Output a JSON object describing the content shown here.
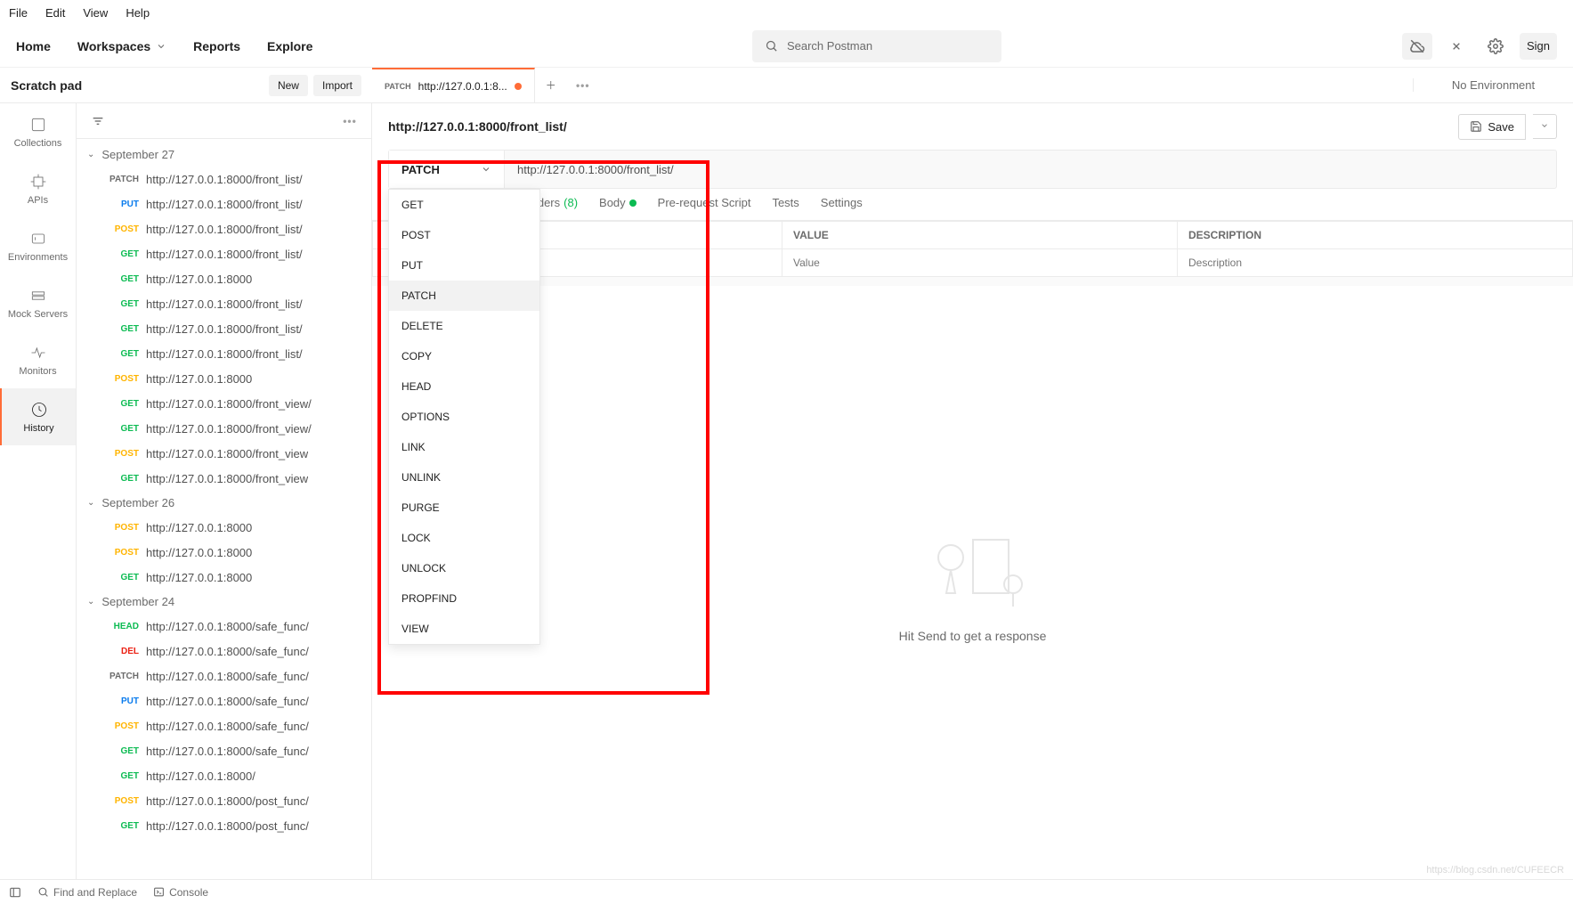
{
  "menu": {
    "file": "File",
    "edit": "Edit",
    "view": "View",
    "help": "Help"
  },
  "header": {
    "home": "Home",
    "workspaces": "Workspaces",
    "reports": "Reports",
    "explore": "Explore",
    "search_placeholder": "Search Postman",
    "sign": "Sign"
  },
  "workspace": {
    "title": "Scratch pad",
    "new": "New",
    "import": "Import"
  },
  "tab": {
    "method": "PATCH",
    "label": "http://127.0.0.1:8...",
    "env": "No Environment"
  },
  "rail": {
    "collections": "Collections",
    "apis": "APIs",
    "environments": "Environments",
    "mockservers": "Mock Servers",
    "monitors": "Monitors",
    "history": "History"
  },
  "history": {
    "groups": [
      {
        "date": "September 27",
        "items": [
          {
            "method": "PATCH",
            "mclass": "m-patch",
            "url": "http://127.0.0.1:8000/front_list/"
          },
          {
            "method": "PUT",
            "mclass": "m-put",
            "url": "http://127.0.0.1:8000/front_list/"
          },
          {
            "method": "POST",
            "mclass": "m-post",
            "url": "http://127.0.0.1:8000/front_list/"
          },
          {
            "method": "GET",
            "mclass": "m-get",
            "url": "http://127.0.0.1:8000/front_list/"
          },
          {
            "method": "GET",
            "mclass": "m-get",
            "url": "http://127.0.0.1:8000"
          },
          {
            "method": "GET",
            "mclass": "m-get",
            "url": "http://127.0.0.1:8000/front_list/"
          },
          {
            "method": "GET",
            "mclass": "m-get",
            "url": "http://127.0.0.1:8000/front_list/"
          },
          {
            "method": "GET",
            "mclass": "m-get",
            "url": "http://127.0.0.1:8000/front_list/"
          },
          {
            "method": "POST",
            "mclass": "m-post",
            "url": "http://127.0.0.1:8000"
          },
          {
            "method": "GET",
            "mclass": "m-get",
            "url": "http://127.0.0.1:8000/front_view/"
          },
          {
            "method": "GET",
            "mclass": "m-get",
            "url": "http://127.0.0.1:8000/front_view/"
          },
          {
            "method": "POST",
            "mclass": "m-post",
            "url": "http://127.0.0.1:8000/front_view"
          },
          {
            "method": "GET",
            "mclass": "m-get",
            "url": "http://127.0.0.1:8000/front_view"
          }
        ]
      },
      {
        "date": "September 26",
        "items": [
          {
            "method": "POST",
            "mclass": "m-post",
            "url": "http://127.0.0.1:8000"
          },
          {
            "method": "POST",
            "mclass": "m-post",
            "url": "http://127.0.0.1:8000"
          },
          {
            "method": "GET",
            "mclass": "m-get",
            "url": "http://127.0.0.1:8000"
          }
        ]
      },
      {
        "date": "September 24",
        "items": [
          {
            "method": "HEAD",
            "mclass": "m-head",
            "url": "http://127.0.0.1:8000/safe_func/"
          },
          {
            "method": "DEL",
            "mclass": "m-del",
            "url": "http://127.0.0.1:8000/safe_func/"
          },
          {
            "method": "PATCH",
            "mclass": "m-patch",
            "url": "http://127.0.0.1:8000/safe_func/"
          },
          {
            "method": "PUT",
            "mclass": "m-put",
            "url": "http://127.0.0.1:8000/safe_func/"
          },
          {
            "method": "POST",
            "mclass": "m-post",
            "url": "http://127.0.0.1:8000/safe_func/"
          },
          {
            "method": "GET",
            "mclass": "m-get",
            "url": "http://127.0.0.1:8000/safe_func/"
          },
          {
            "method": "GET",
            "mclass": "m-get",
            "url": "http://127.0.0.1:8000/"
          },
          {
            "method": "POST",
            "mclass": "m-post",
            "url": "http://127.0.0.1:8000/post_func/"
          },
          {
            "method": "GET",
            "mclass": "m-get",
            "url": "http://127.0.0.1:8000/post_func/"
          }
        ]
      }
    ]
  },
  "request": {
    "name": "http://127.0.0.1:8000/front_list/",
    "save": "Save",
    "method": "PATCH",
    "url": "http://127.0.0.1:8000/front_list/",
    "methods": [
      "GET",
      "POST",
      "PUT",
      "PATCH",
      "DELETE",
      "COPY",
      "HEAD",
      "OPTIONS",
      "LINK",
      "UNLINK",
      "PURGE",
      "LOCK",
      "UNLOCK",
      "PROPFIND",
      "VIEW"
    ],
    "tabs": {
      "headers": "Headers",
      "headers_count": "(8)",
      "body": "Body",
      "prerequest": "Pre-request Script",
      "tests": "Tests",
      "settings": "Settings"
    },
    "kv": {
      "value_header": "VALUE",
      "desc_header": "DESCRIPTION",
      "value_ph": "Value",
      "desc_ph": "Description"
    }
  },
  "response": {
    "empty": "Hit Send to get a response"
  },
  "statusbar": {
    "find": "Find and Replace",
    "console": "Console"
  },
  "watermark": "https://blog.csdn.net/CUFEECR"
}
